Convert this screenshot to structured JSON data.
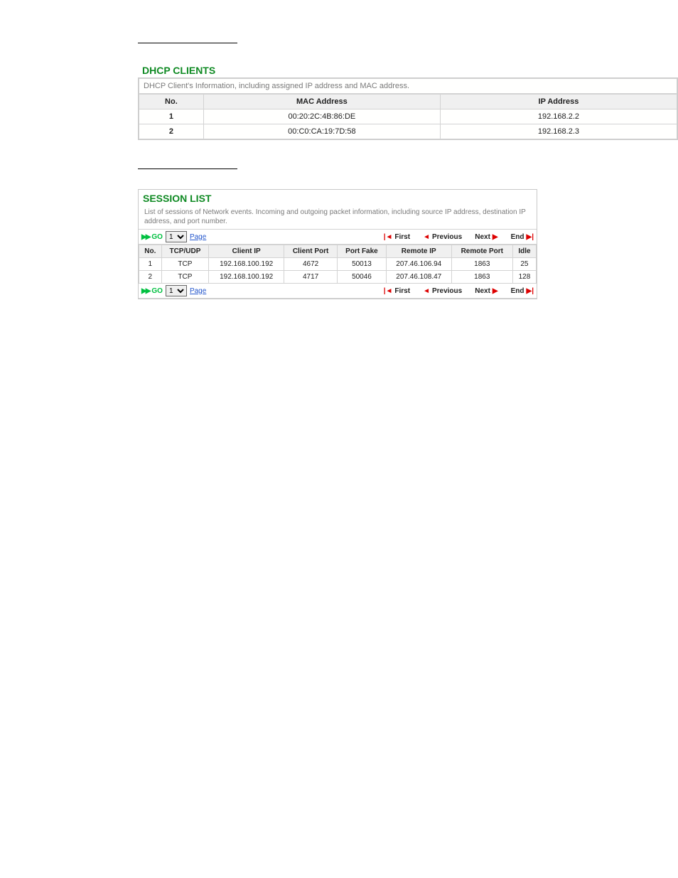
{
  "dhcp": {
    "title": "DHCP CLIENTS",
    "desc": "DHCP Client's Information, including assigned IP address and MAC address.",
    "headers": {
      "no": "No.",
      "mac": "MAC Address",
      "ip": "IP Address"
    },
    "rows": [
      {
        "no": "1",
        "mac": "00:20:2C:4B:86:DE",
        "ip": "192.168.2.2"
      },
      {
        "no": "2",
        "mac": "00:C0:CA:19:7D:58",
        "ip": "192.168.2.3"
      }
    ]
  },
  "session": {
    "title": "SESSION LIST",
    "desc": "List of sessions of Network events. Incoming and outgoing packet information, including source IP address, destination IP address, and port number.",
    "go": "GO",
    "page_sel": "1",
    "page_link": "Page",
    "nav": {
      "first": "First",
      "prev": "Previous",
      "next": "Next",
      "end": "End"
    },
    "headers": {
      "no": "No.",
      "proto": "TCP/UDP",
      "cip": "Client IP",
      "cport": "Client Port",
      "pfake": "Port Fake",
      "rip": "Remote IP",
      "rport": "Remote Port",
      "idle": "Idle"
    },
    "rows": [
      {
        "no": "1",
        "proto": "TCP",
        "cip": "192.168.100.192",
        "cport": "4672",
        "pfake": "50013",
        "rip": "207.46.106.94",
        "rport": "1863",
        "idle": "25"
      },
      {
        "no": "2",
        "proto": "TCP",
        "cip": "192.168.100.192",
        "cport": "4717",
        "pfake": "50046",
        "rip": "207.46.108.47",
        "rport": "1863",
        "idle": "128"
      }
    ]
  }
}
